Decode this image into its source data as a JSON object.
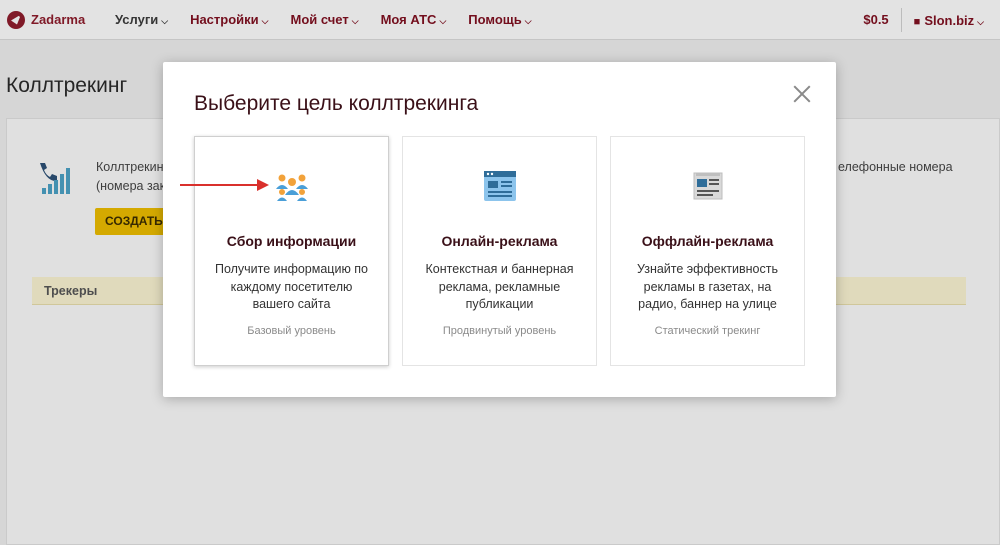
{
  "nav": {
    "logo_text": "Zadarma",
    "items": [
      {
        "label": "Услуги"
      },
      {
        "label": "Настройки"
      },
      {
        "label": "Мой счет"
      },
      {
        "label": "Моя АТС"
      },
      {
        "label": "Помощь"
      }
    ],
    "balance": "$0.5",
    "account": "Slon.biz"
  },
  "page": {
    "title": "Коллтрекинг",
    "desc_line1": "Коллтрекин",
    "desc_line2": "(номера зак",
    "desc_right": "елефонные номера",
    "create_label": "СОЗДАТЬ",
    "trackers_label": "Трекеры"
  },
  "modal": {
    "title": "Выберите цель коллтрекинга",
    "cards": [
      {
        "title": "Сбор информации",
        "desc": "Получите информацию по каждому посетителю вашего сайта",
        "level": "Базовый уровень",
        "icon": "people-group-icon"
      },
      {
        "title": "Онлайн-реклама",
        "desc": "Контекстная и баннерная реклама, рекламные публикации",
        "level": "Продвинутый уровень",
        "icon": "browser-window-icon"
      },
      {
        "title": "Оффлайн-реклама",
        "desc": "Узнайте эффективность рекламы в газетах, на радио, баннер на улице",
        "level": "Статический трекинг",
        "icon": "newspaper-icon"
      }
    ]
  },
  "colors": {
    "brand": "#7d1020",
    "create_button": "#e6b800",
    "arrow": "#d9302c"
  }
}
